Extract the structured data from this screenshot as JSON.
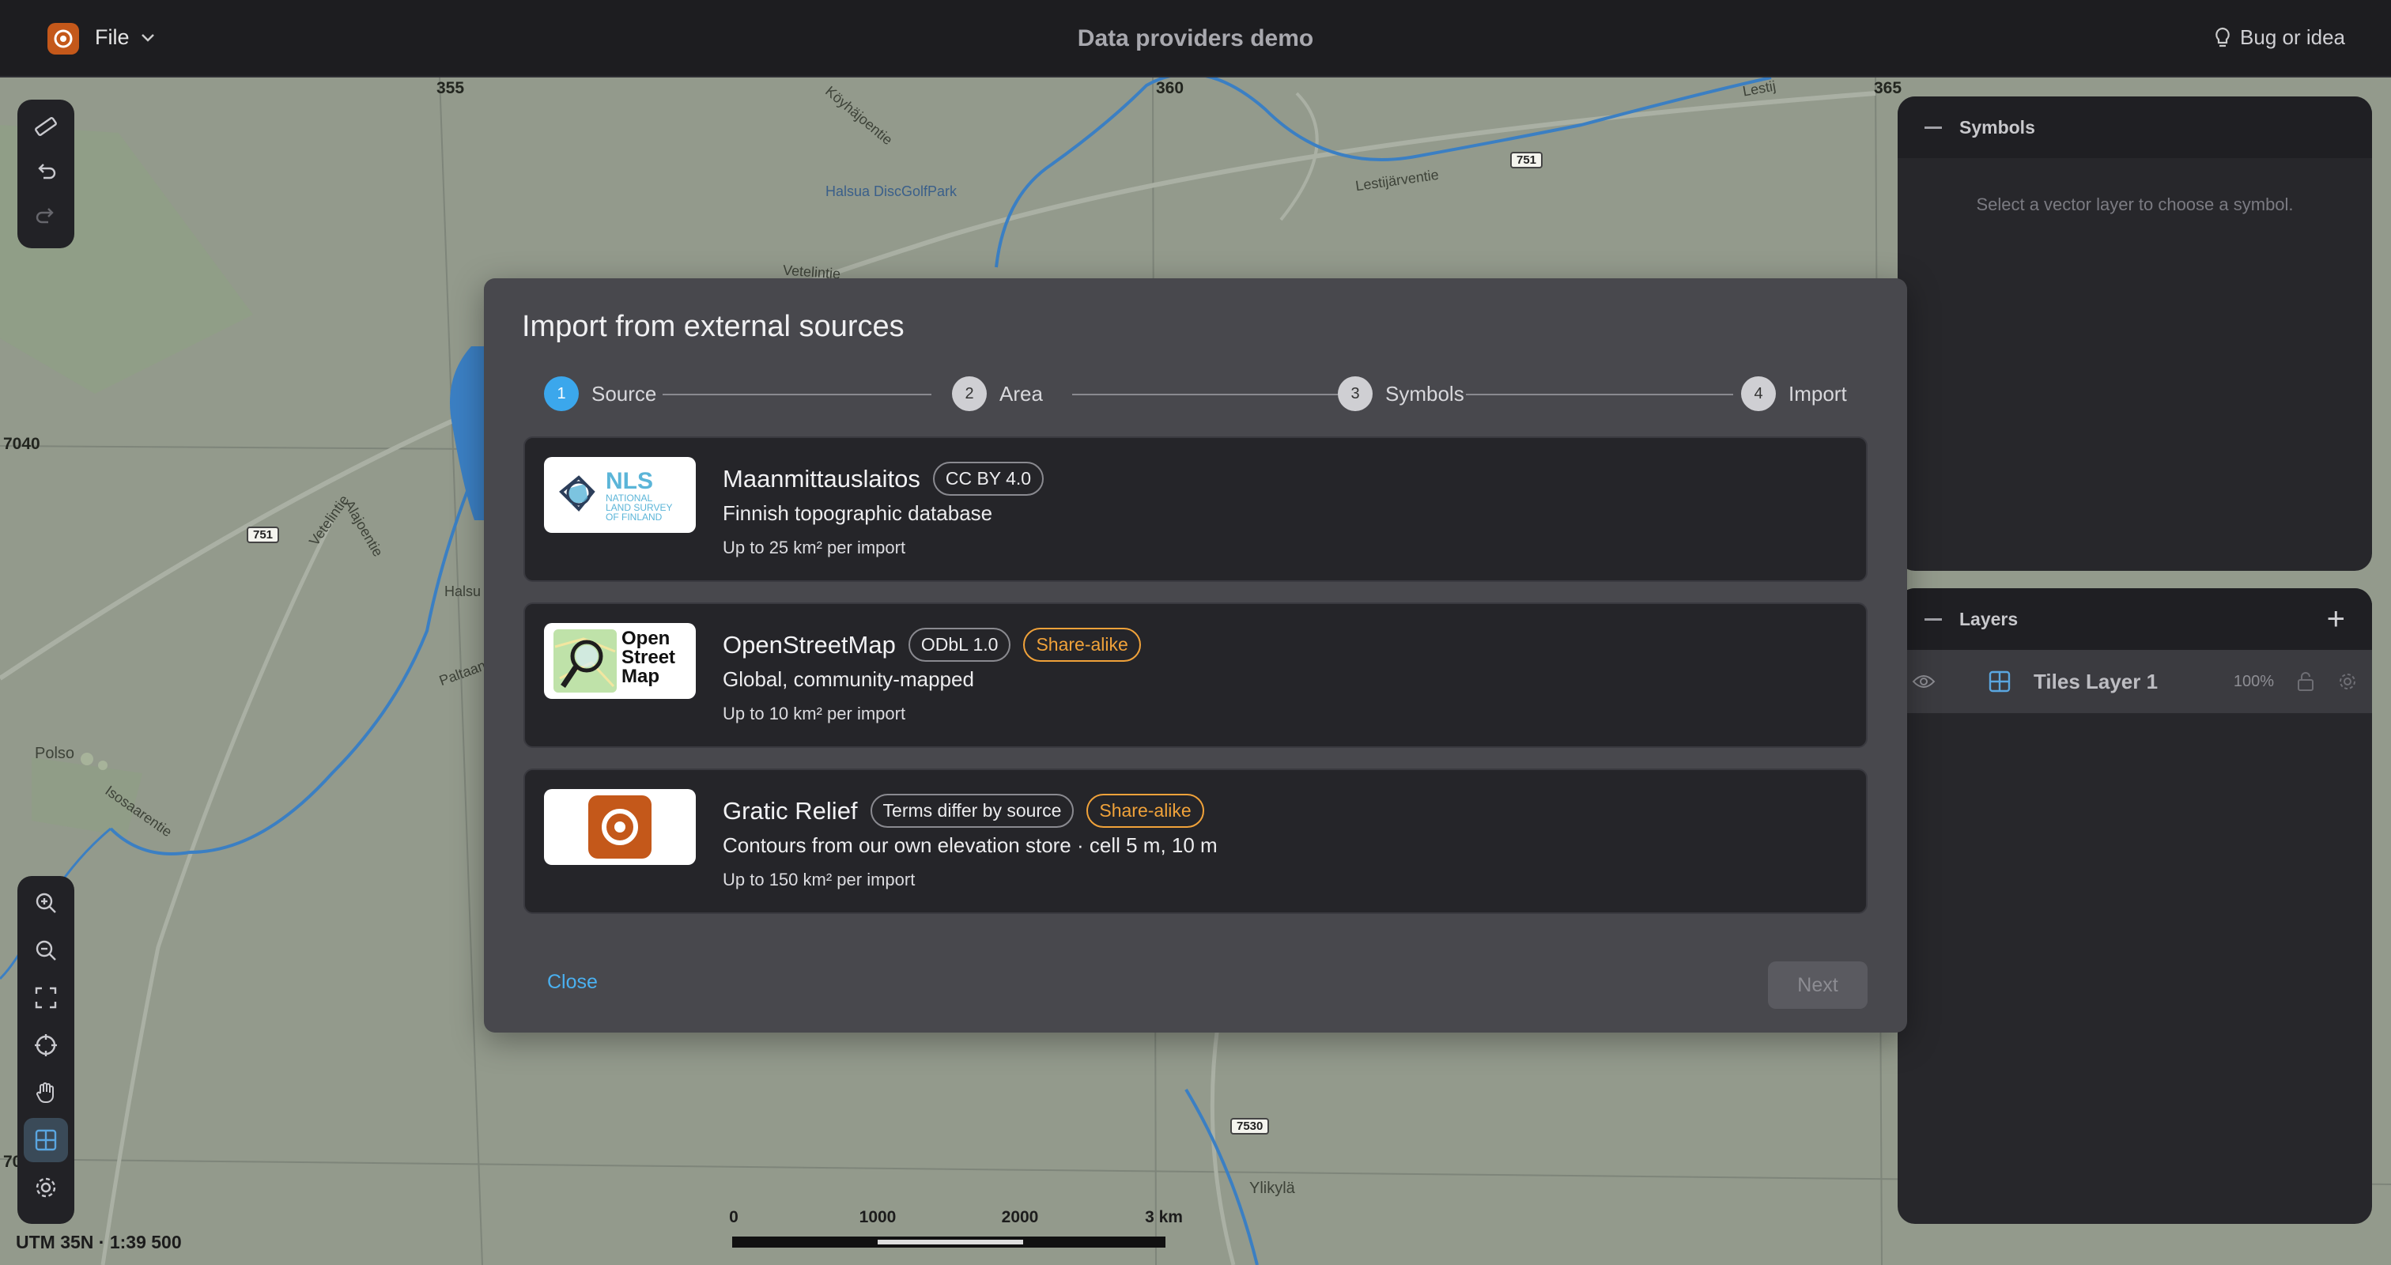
{
  "topbar": {
    "file_label": "File",
    "title": "Data providers demo",
    "feedback_label": "Bug or idea"
  },
  "map": {
    "grid_labels": {
      "x355": "355",
      "x360": "360",
      "x365": "365",
      "y7040": "7040",
      "y70": "70"
    },
    "place_labels": {
      "golf": "Halsua DiscGolfPark",
      "lestijarventie": "Lestijärventie",
      "lestij": "Lestij",
      "koyhajoentie": "Köyhäjoentie",
      "veteliantie": "Vetelintie",
      "vetelintie2": "Vetelintie",
      "polso": "Polso",
      "isosaarentie": "Isosaarentie",
      "ylikyla": "Ylikylä",
      "alajoentie": "Alajoentie",
      "paltaantie": "Paltaantie",
      "halsu": "Halsu"
    },
    "road_shields": {
      "r751a": "751",
      "r751b": "751",
      "r7530": "7530"
    },
    "status_readout": "UTM 35N · 1:39 500",
    "scale_ticks": [
      "0",
      "1000",
      "2000",
      "3 km"
    ]
  },
  "symbols_panel": {
    "title": "Symbols",
    "empty_text": "Select a vector layer to choose a symbol."
  },
  "layers_panel": {
    "title": "Layers",
    "layers": [
      {
        "name": "Tiles Layer 1",
        "opacity": "100%"
      }
    ]
  },
  "modal": {
    "title": "Import from external sources",
    "steps": [
      {
        "number": "1",
        "label": "Source"
      },
      {
        "number": "2",
        "label": "Area"
      },
      {
        "number": "3",
        "label": "Symbols"
      },
      {
        "number": "4",
        "label": "Import"
      }
    ],
    "providers": [
      {
        "name": "Maanmittauslaitos",
        "badges": [
          "CC BY 4.0"
        ],
        "description": "Finnish topographic database",
        "limit": "Up to 25 km² per import",
        "logo_text": {
          "abbr": "NLS",
          "l1": "NATIONAL",
          "l2": "LAND SURVEY",
          "l3": "OF FINLAND"
        }
      },
      {
        "name": "OpenStreetMap",
        "badges": [
          "ODbL 1.0",
          "Share-alike"
        ],
        "description": "Global, community-mapped",
        "limit": "Up to 10 km² per import",
        "logo_text": {
          "l1": "Open",
          "l2": "Street",
          "l3": "Map"
        }
      },
      {
        "name": "Gratic Relief",
        "badges": [
          "Terms differ by source",
          "Share-alike"
        ],
        "description": "Contours from our own elevation store · cell 5 m, 10 m",
        "limit": "Up to 150 km² per import"
      }
    ],
    "close_label": "Close",
    "next_label": "Next"
  },
  "colors": {
    "accent": "#3ba7ec",
    "brand": "#c4581a",
    "warning": "#f0a23a"
  }
}
